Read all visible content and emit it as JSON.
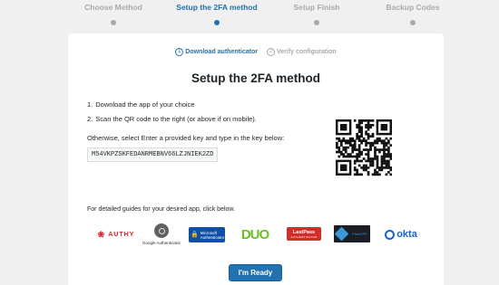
{
  "stepper": {
    "steps": [
      {
        "label": "Choose Method",
        "active": false
      },
      {
        "label": "Setup the 2FA method",
        "active": true
      },
      {
        "label": "Setup Finish",
        "active": false
      },
      {
        "label": "Backup Codes",
        "active": false
      }
    ]
  },
  "substeps": [
    {
      "num": "1",
      "label": "Download authenticator",
      "active": true
    },
    {
      "num": "2",
      "label": "Verify configuration",
      "active": false
    }
  ],
  "title": "Setup the 2FA method",
  "instructions": [
    {
      "idx": "1.",
      "text": "Download the app of your choice"
    },
    {
      "idx": "2.",
      "text": "Scan the QR code to the right (or above if on mobile)."
    }
  ],
  "otherwise_text": "Otherwise, select Enter a provided key and type in the key below:",
  "secret_key": "M54VKPZSKFEDANRMEBNV66LZJNIEK2ZD",
  "guides_text": "For detailed guides for your desired app, click below.",
  "apps": {
    "authy": "AUTHY",
    "google_label": "Google Authenticator",
    "ms_line1": "Microsoft",
    "ms_line2": "Authenticator",
    "duo": "DUO",
    "lastpass": "LastPass",
    "lastpass_sub": "AUTHENTICATOR",
    "freeotp": "FreeOTP",
    "okta": "okta"
  },
  "ready_button": "I'm Ready",
  "colors": {
    "accent": "#2271b1",
    "inactive": "#a7aaad",
    "background": "#f0f0f1"
  }
}
